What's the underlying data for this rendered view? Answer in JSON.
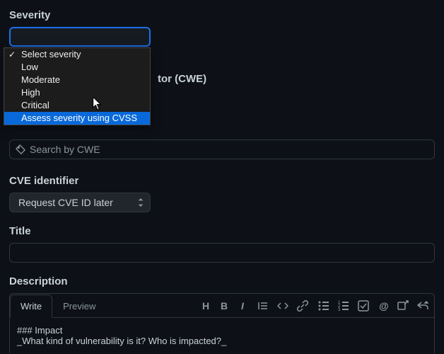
{
  "severity": {
    "label": "Severity",
    "placeholder": "Select severity",
    "options": [
      "Select severity",
      "Low",
      "Moderate",
      "High",
      "Critical",
      "Assess severity using CVSS"
    ],
    "selected_index": 0,
    "highlighted_index": 5
  },
  "cwe": {
    "label_fragment": "tor (CWE)",
    "search_placeholder": "Search by CWE"
  },
  "cve": {
    "label": "CVE identifier",
    "selected": "Request CVE ID later"
  },
  "title": {
    "label": "Title",
    "value": ""
  },
  "description": {
    "label": "Description",
    "tabs": {
      "write": "Write",
      "preview": "Preview"
    },
    "body_line1": "### Impact",
    "body_line2": "_What kind of vulnerability is it? Who is impacted?_"
  }
}
